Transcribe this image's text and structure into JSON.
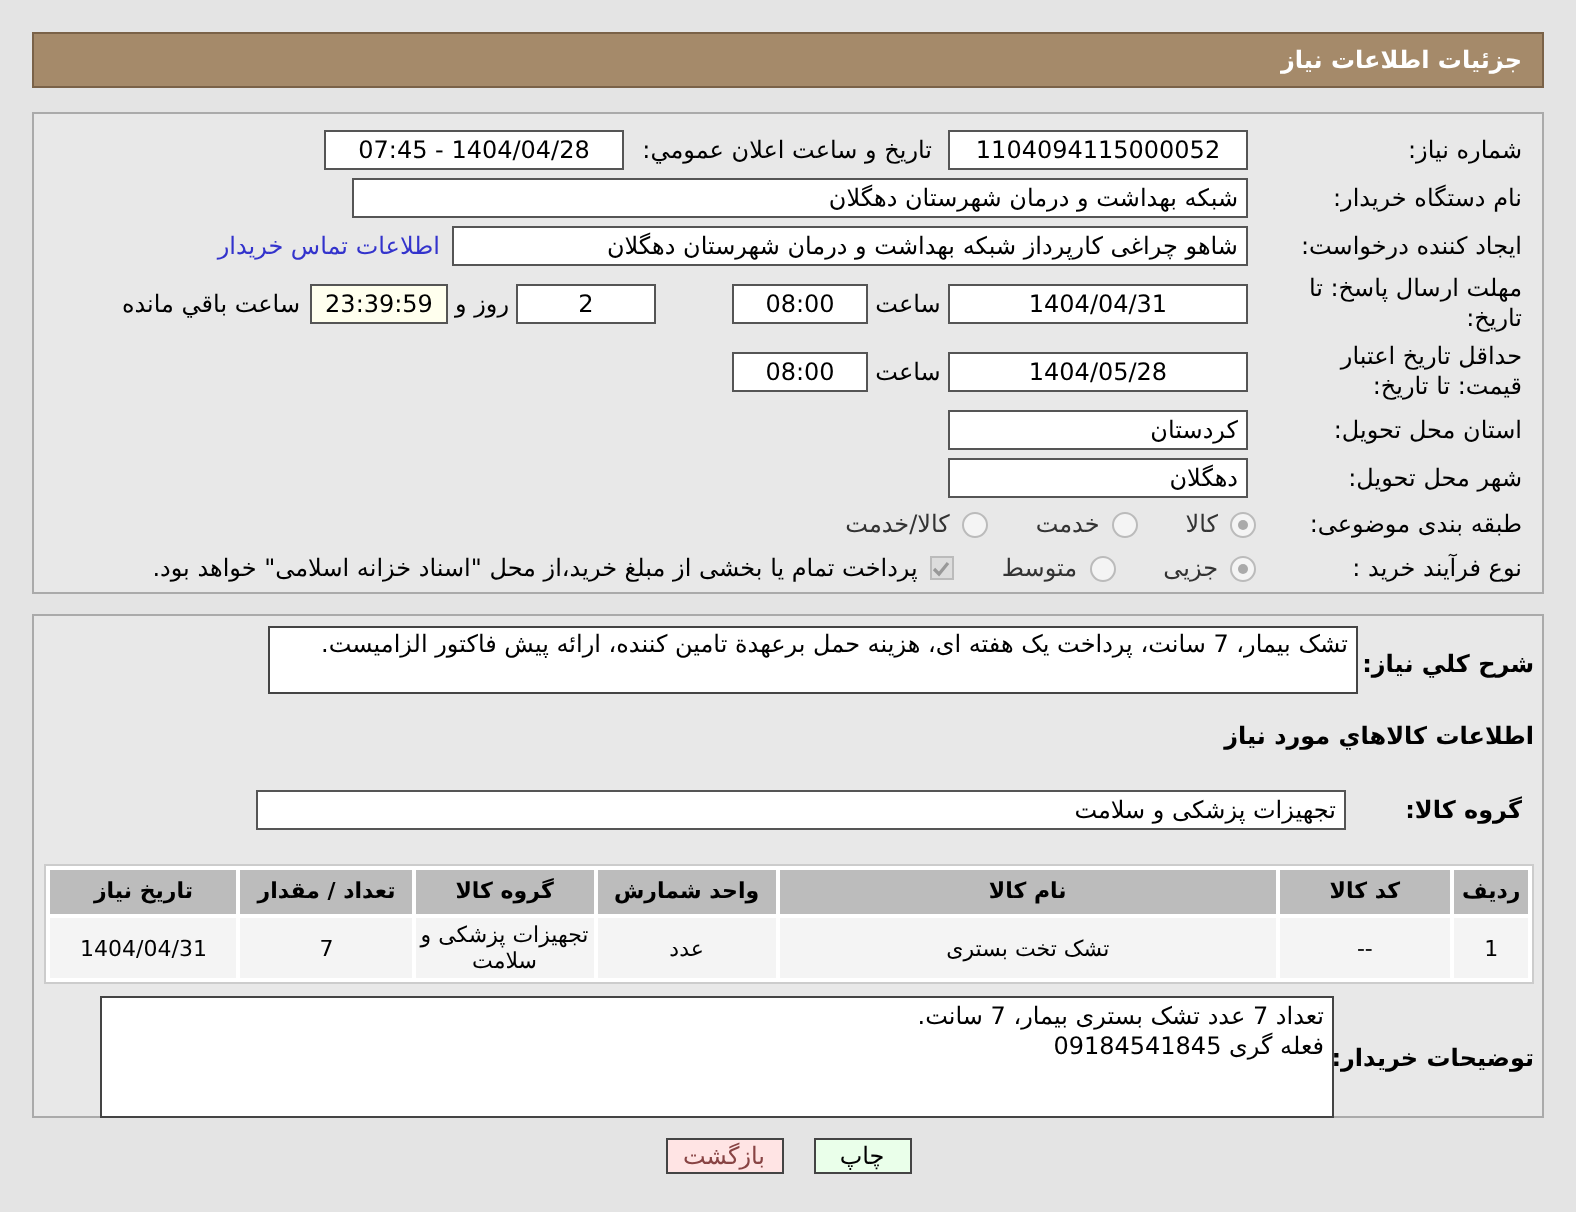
{
  "header": {
    "title": "جزئیات اطلاعات نیاز"
  },
  "need_number": {
    "label": "شماره نیاز:",
    "value": "1104094115000052"
  },
  "announce": {
    "label": "تاریخ و ساعت اعلان عمومي:",
    "value": "1404/04/28 - 07:45"
  },
  "buyer_org": {
    "label": "نام دستگاه خریدار:",
    "value": "شبکه بهداشت و درمان شهرستان دهگلان"
  },
  "requester": {
    "label": "ایجاد کننده درخواست:",
    "value": "شاهو چراغی کارپرداز شبکه بهداشت و درمان شهرستان دهگلان",
    "link": "اطلاعات تماس خریدار"
  },
  "deadline": {
    "label": "مهلت ارسال پاسخ: تا تاریخ:",
    "date": "1404/04/31",
    "time_label": "ساعت",
    "time": "08:00",
    "days": "2",
    "days_label": "روز و",
    "remaining": "23:39:59",
    "remaining_label": "ساعت باقي مانده"
  },
  "validity": {
    "label": "حداقل تاریخ اعتبار قیمت: تا تاریخ:",
    "date": "1404/05/28",
    "time_label": "ساعت",
    "time": "08:00"
  },
  "province": {
    "label": "استان محل تحویل:",
    "value": "کردستان"
  },
  "city": {
    "label": "شهر محل تحویل:",
    "value": "دهگلان"
  },
  "category": {
    "label": "طبقه بندی موضوعی:",
    "options": [
      {
        "label": "كالا",
        "selected": true
      },
      {
        "label": "خدمت",
        "selected": false
      },
      {
        "label": "كالا/خدمت",
        "selected": false
      }
    ]
  },
  "process": {
    "label": "نوع فرآیند خرید :",
    "options": [
      {
        "label": "جزیی",
        "selected": true
      },
      {
        "label": "متوسط",
        "selected": false
      }
    ],
    "treasury": {
      "checked": true,
      "text": "پرداخت تمام یا بخشی از مبلغ خرید،از محل \"اسناد خزانه اسلامی\" خواهد بود."
    }
  },
  "description": {
    "label": "شرح کلي نیاز:",
    "value": "تشک بیمار، 7 سانت، پرداخت یک هفته ای، هزینه حمل برعهدة تامین کننده، ارائه پیش فاکتور الزامیست."
  },
  "goods_heading": "اطلاعات کالاهاي مورد نیاز",
  "goods_group": {
    "label": "گروه کالا:",
    "value": "تجهیزات پزشکی و سلامت"
  },
  "table": {
    "columns": [
      "ردیف",
      "کد کالا",
      "نام کالا",
      "واحد شمارش",
      "گروه کالا",
      "تعداد / مقدار",
      "تاریخ نیاز"
    ],
    "rows": [
      [
        "1",
        "--",
        "تشک تخت بستری",
        "عدد",
        "تجهیزات پزشکی و سلامت",
        "7",
        "1404/04/31"
      ]
    ]
  },
  "buyer_notes": {
    "label": "توضیحات خریدار:",
    "lines": [
      "تعداد 7 عدد تشک بستری بیمار، 7 سانت.",
      "فعله گری 09184541845"
    ]
  },
  "buttons": [
    {
      "kind": "print",
      "label": "چاپ"
    },
    {
      "kind": "back",
      "label": "بازگشت"
    }
  ]
}
